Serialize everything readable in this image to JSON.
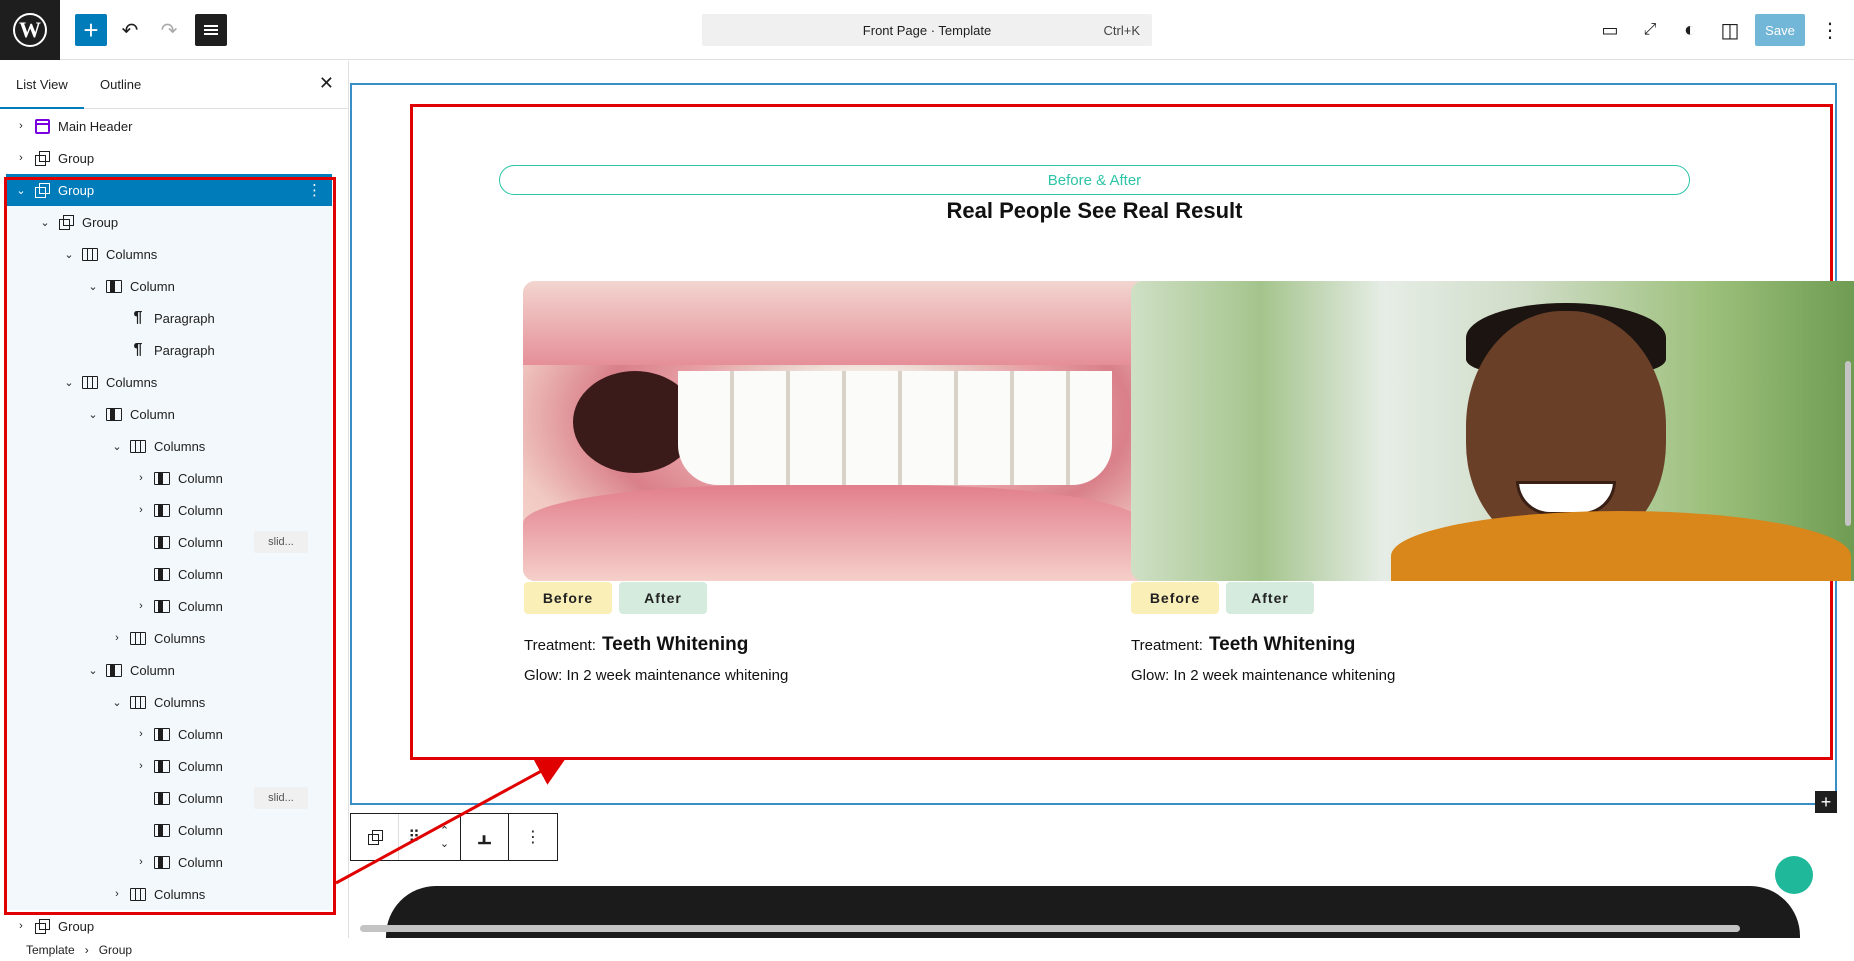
{
  "topbar": {
    "command_bar": "Front Page · Template",
    "shortcut": "Ctrl+K",
    "save_label": "Save"
  },
  "sidebar": {
    "tabs": [
      "List View",
      "Outline"
    ],
    "rows": [
      {
        "label": "Main Header",
        "icon": "header-icon",
        "depth": 0,
        "chev": ">"
      },
      {
        "label": "Group",
        "icon": "group-icon",
        "depth": 0,
        "chev": ">"
      },
      {
        "label": "Group",
        "icon": "group-icon",
        "depth": 0,
        "chev": "v",
        "selected": true
      },
      {
        "label": "Group",
        "icon": "group-icon",
        "depth": 1,
        "chev": "v"
      },
      {
        "label": "Columns",
        "icon": "columns-icon",
        "depth": 2,
        "chev": "v"
      },
      {
        "label": "Column",
        "icon": "column-icon",
        "depth": 3,
        "chev": "v"
      },
      {
        "label": "Paragraph",
        "icon": "paragraph-icon",
        "depth": 4,
        "chev": ""
      },
      {
        "label": "Paragraph",
        "icon": "paragraph-icon",
        "depth": 4,
        "chev": ""
      },
      {
        "label": "Columns",
        "icon": "columns-icon",
        "depth": 2,
        "chev": "v"
      },
      {
        "label": "Column",
        "icon": "column-icon",
        "depth": 3,
        "chev": "v"
      },
      {
        "label": "Columns",
        "icon": "columns-icon",
        "depth": 4,
        "chev": "v"
      },
      {
        "label": "Column",
        "icon": "column-icon",
        "depth": 5,
        "chev": ">"
      },
      {
        "label": "Column",
        "icon": "column-icon",
        "depth": 5,
        "chev": ">"
      },
      {
        "label": "Column",
        "icon": "column-icon",
        "depth": 5,
        "chev": "",
        "badge": "slid..."
      },
      {
        "label": "Column",
        "icon": "column-icon",
        "depth": 5,
        "chev": ""
      },
      {
        "label": "Column",
        "icon": "column-icon",
        "depth": 5,
        "chev": ">"
      },
      {
        "label": "Columns",
        "icon": "columns-icon",
        "depth": 4,
        "chev": ">"
      },
      {
        "label": "Column",
        "icon": "column-icon",
        "depth": 3,
        "chev": "v"
      },
      {
        "label": "Columns",
        "icon": "columns-icon",
        "depth": 4,
        "chev": "v"
      },
      {
        "label": "Column",
        "icon": "column-icon",
        "depth": 5,
        "chev": ">"
      },
      {
        "label": "Column",
        "icon": "column-icon",
        "depth": 5,
        "chev": ">"
      },
      {
        "label": "Column",
        "icon": "column-icon",
        "depth": 5,
        "chev": "",
        "badge": "slid..."
      },
      {
        "label": "Column",
        "icon": "column-icon",
        "depth": 5,
        "chev": ""
      },
      {
        "label": "Column",
        "icon": "column-icon",
        "depth": 5,
        "chev": ">"
      },
      {
        "label": "Columns",
        "icon": "columns-icon",
        "depth": 4,
        "chev": ">"
      },
      {
        "label": "Group",
        "icon": "group-icon",
        "depth": 0,
        "chev": ">"
      }
    ]
  },
  "breadcrumb": [
    "Template",
    "Group"
  ],
  "content": {
    "pill": "Before & After",
    "heading": "Real People See Real Result",
    "cards": [
      {
        "before": "Before",
        "after": "After",
        "treatment_label": "Treatment:",
        "treatment": "Teeth Whitening",
        "glow_label": "Glow:",
        "glow": "In 2 week maintenance whitening"
      },
      {
        "before": "Before",
        "after": "After",
        "treatment_label": "Treatment:",
        "treatment": "Teeth Whitening",
        "glow_label": "Glow:",
        "glow": "In 2 week maintenance whitening"
      }
    ]
  },
  "colors": {
    "accent": "#007cba",
    "highlight": "#e00000",
    "teal": "#2ec4a6"
  }
}
